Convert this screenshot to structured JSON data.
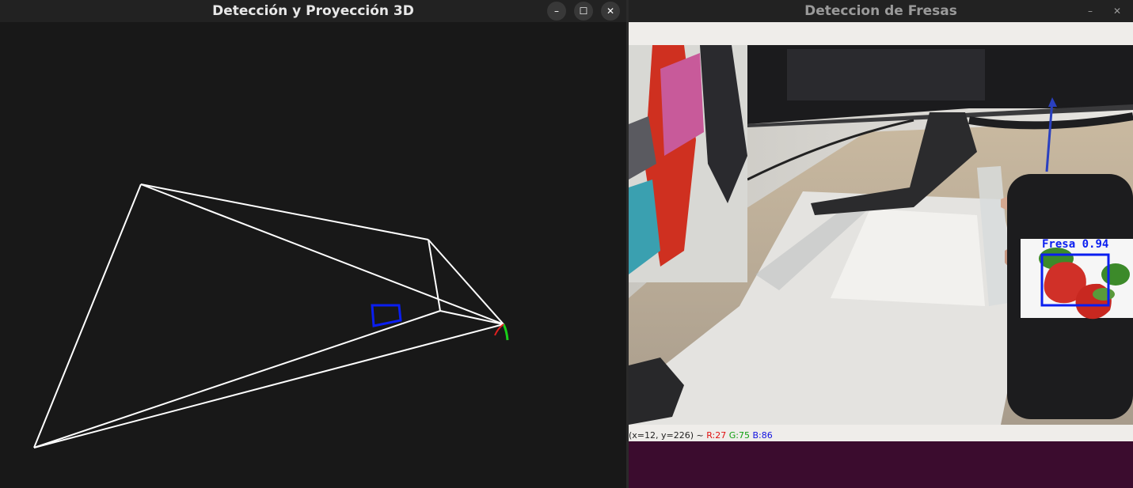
{
  "left_window": {
    "title": "Detección y Proyección 3D",
    "buttons": {
      "minimize": "–",
      "maximize": "☐",
      "close": "✕"
    }
  },
  "right_window": {
    "title": "Deteccion de Fresas",
    "buttons": {
      "minimize": "–",
      "close": "✕"
    },
    "detection": {
      "label": "Fresa",
      "confidence": "0.94"
    },
    "status": {
      "coords": "(x=12, y=226) ~",
      "r": "R:27",
      "g": "G:75",
      "b": "B:86"
    }
  },
  "colors": {
    "bbox": "#0a1ef0",
    "desktop": "#3b0c2e",
    "scene_bg": "#181818"
  }
}
